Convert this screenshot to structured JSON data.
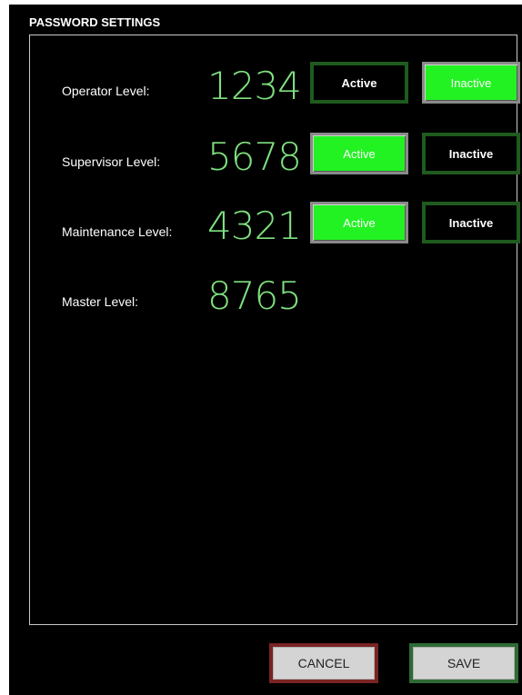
{
  "header": {
    "title": "PASSWORD SETTINGS"
  },
  "levels": [
    {
      "label": "Operator Level:",
      "code": "1234",
      "active_label": "Active",
      "inactive_label": "Inactive",
      "state": "inactive"
    },
    {
      "label": "Supervisor Level:",
      "code": "5678",
      "active_label": "Active",
      "inactive_label": "Inactive",
      "state": "active"
    },
    {
      "label": "Maintenance Level:",
      "code": "4321",
      "active_label": "Active",
      "inactive_label": "Inactive",
      "state": "active"
    },
    {
      "label": "Master Level:",
      "code": "8765"
    }
  ],
  "footer": {
    "cancel_label": "CANCEL",
    "save_label": "SAVE"
  },
  "colors": {
    "background": "#000000",
    "code_green": "#7ee07e",
    "button_on": "#22f222",
    "button_off_border": "#1f5a1f",
    "cancel_border": "#7a2323",
    "save_border": "#2f6a34"
  }
}
